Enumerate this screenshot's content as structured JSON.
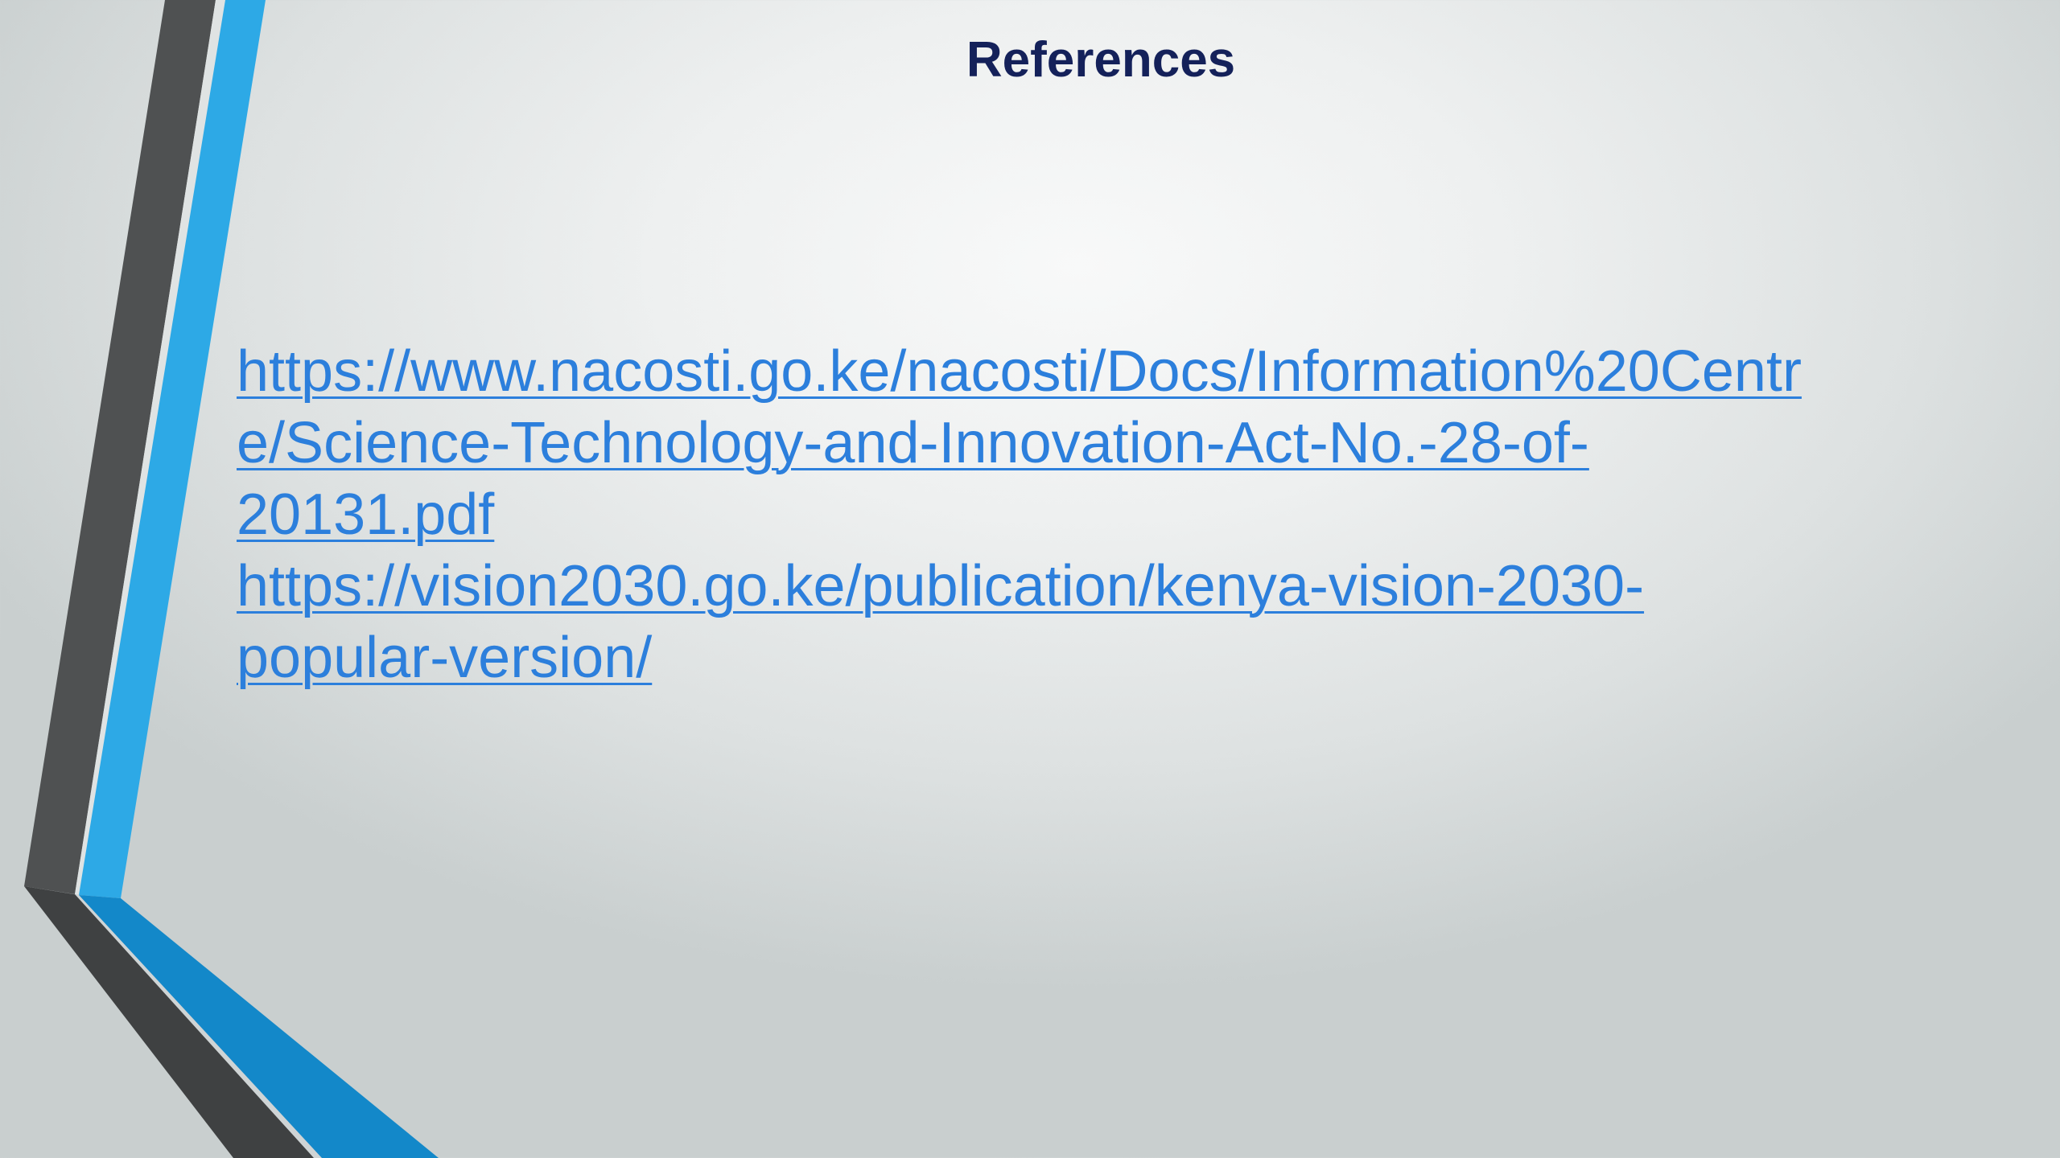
{
  "slide": {
    "title": "References",
    "references": [
      {
        "lines": [
          "https://www.nacosti.go.ke/nacosti/Docs/Information%20Centr",
          "e/Science-Technology-and-Innovation-Act-No.-28-of-",
          "20131.pdf"
        ]
      },
      {
        "lines": [
          "https://vision2030.go.ke/publication/kenya-vision-2030-",
          "popular-version/"
        ]
      }
    ]
  },
  "theme": {
    "title_color": "#14215a",
    "link_color": "#2c7fdc",
    "accent_blue": "#2da9e6",
    "accent_dark_gray": "#4f5152"
  }
}
